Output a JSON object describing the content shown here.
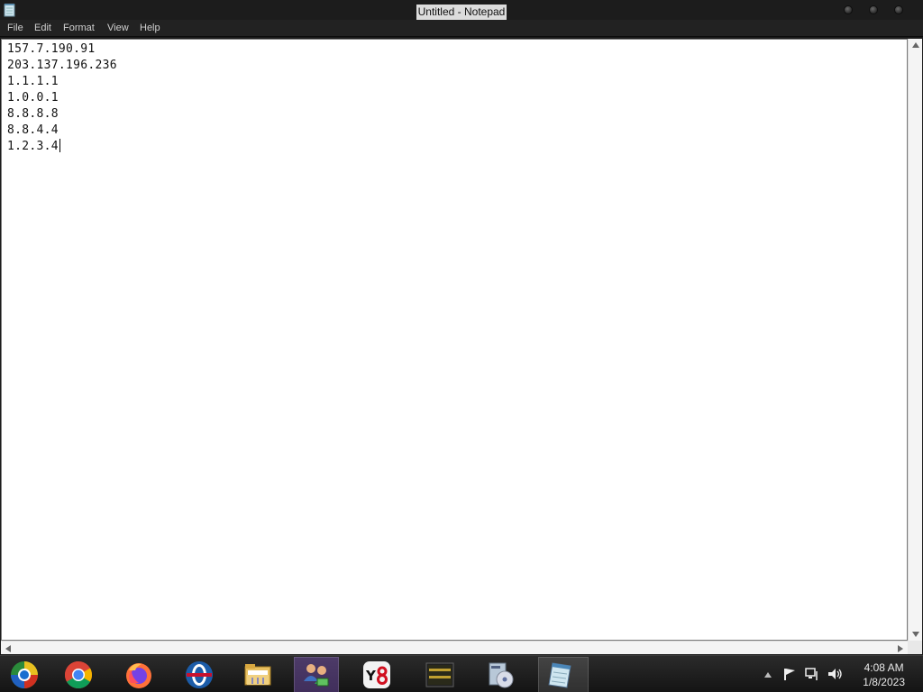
{
  "window": {
    "title": "Untitled - Notepad",
    "controls": [
      "minimize",
      "maximize",
      "close"
    ]
  },
  "menu": {
    "items": [
      "File",
      "Edit",
      "Format",
      "View",
      "Help"
    ]
  },
  "editor": {
    "lines": [
      "157.7.190.91",
      "203.137.196.236",
      "1.1.1.1",
      "1.0.0.1",
      "8.8.8.8",
      "8.8.4.4",
      "1.2.3.4"
    ]
  },
  "taskbar": {
    "pinned": [
      "windows-media-center-icon",
      "chrome-icon",
      "firefox-icon",
      "opera-icon",
      "file-explorer-icon",
      "network-users-icon",
      "y8-icon",
      "warning-console-icon",
      "disk-cleanup-icon",
      "notepad-icon"
    ],
    "tray_icons": [
      "show-hidden-icons-arrow",
      "action-center-flag-icon",
      "network-icon",
      "volume-icon"
    ],
    "clock": {
      "time": "4:08 AM",
      "date": "1/8/2023"
    }
  },
  "colors": {
    "titlebar": "#1c1c1c",
    "menubar": "#222222",
    "editor_bg": "#ffffff",
    "taskbar": "#1a1a1a"
  }
}
